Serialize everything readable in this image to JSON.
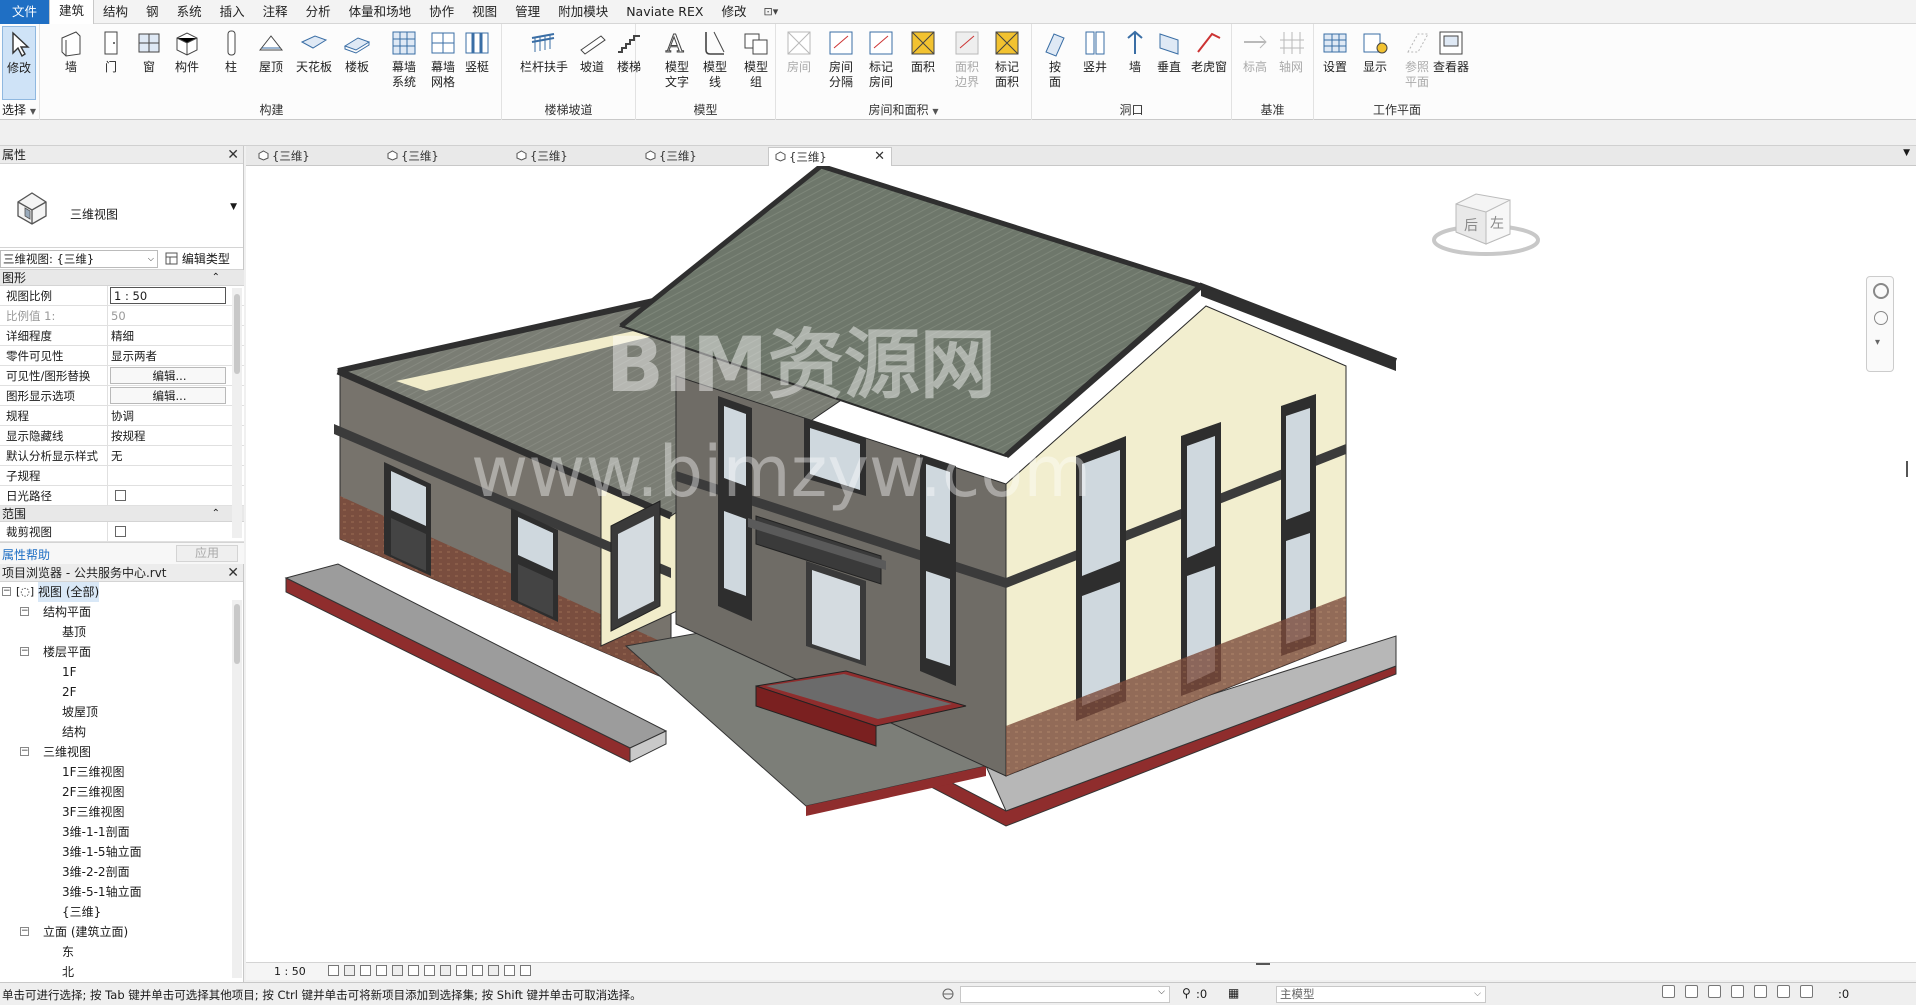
{
  "menu": {
    "items": [
      "文件",
      "建筑",
      "结构",
      "钢",
      "系统",
      "插入",
      "注释",
      "分析",
      "体量和场地",
      "协作",
      "视图",
      "管理",
      "附加模块",
      "Naviate REX",
      "修改"
    ],
    "active_index": 1
  },
  "ribbon": {
    "select": {
      "modify": "修改",
      "label": "选择"
    },
    "build": {
      "label": "构建",
      "buttons": [
        "墙",
        "门",
        "窗",
        "构件",
        "柱",
        "屋顶",
        "天花板",
        "楼板",
        "幕墙\n系统",
        "幕墙\n网格",
        "竖梃"
      ]
    },
    "circulation": {
      "label": "楼梯坡道",
      "buttons": [
        "栏杆扶手",
        "坡道",
        "楼梯"
      ]
    },
    "model": {
      "label": "模型",
      "buttons": [
        "模型\n文字",
        "模型\n线",
        "模型\n组"
      ]
    },
    "room_area": {
      "label": "房间和面积",
      "buttons": [
        "房间",
        "房间\n分隔",
        "标记\n房间",
        "面积",
        "面积\n边界",
        "标记\n面积"
      ]
    },
    "opening": {
      "label": "洞口",
      "buttons": [
        "按\n面",
        "竖井",
        "墙",
        "垂直",
        "老虎窗"
      ]
    },
    "datum": {
      "label": "基准",
      "buttons": [
        "标高",
        "轴网"
      ]
    },
    "workplane": {
      "label": "工作平面",
      "buttons": [
        "设置",
        "显示",
        "参照\n平面",
        "查看器"
      ]
    }
  },
  "properties": {
    "title": "属性",
    "type_name": "三维视图",
    "instance": "三维视图: {三维}",
    "edit_type": "编辑类型",
    "sections": [
      {
        "name": "图形",
        "rows": [
          {
            "name": "视图比例",
            "value": "1 : 50",
            "style": "boxed"
          },
          {
            "name": "比例值 1:",
            "value": "50",
            "style": "dim"
          },
          {
            "name": "详细程度",
            "value": "精细"
          },
          {
            "name": "零件可见性",
            "value": "显示两者"
          },
          {
            "name": "可见性/图形替换",
            "value": "编辑...",
            "style": "btn"
          },
          {
            "name": "图形显示选项",
            "value": "编辑...",
            "style": "btn"
          },
          {
            "name": "规程",
            "value": "协调"
          },
          {
            "name": "显示隐藏线",
            "value": "按规程"
          },
          {
            "name": "默认分析显示样式",
            "value": "无"
          },
          {
            "name": "子规程",
            "value": ""
          },
          {
            "name": "日光路径",
            "value": "",
            "style": "checkbox"
          }
        ]
      },
      {
        "name": "范围",
        "rows": [
          {
            "name": "裁剪视图",
            "value": "",
            "style": "checkbox"
          }
        ]
      }
    ],
    "help": "属性帮助",
    "apply": "应用"
  },
  "browser": {
    "title": "项目浏览器 - 公共服务中心.rvt",
    "tree": [
      {
        "label": "视图 (全部)",
        "level": 0,
        "toggle": "−",
        "selected": true
      },
      {
        "label": "结构平面",
        "level": 1,
        "toggle": "−"
      },
      {
        "label": "基顶",
        "level": 2
      },
      {
        "label": "楼层平面",
        "level": 1,
        "toggle": "−"
      },
      {
        "label": "1F",
        "level": 2
      },
      {
        "label": "2F",
        "level": 2
      },
      {
        "label": "坡屋顶",
        "level": 2
      },
      {
        "label": "结构",
        "level": 2
      },
      {
        "label": "三维视图",
        "level": 1,
        "toggle": "−"
      },
      {
        "label": "1F三维视图",
        "level": 2
      },
      {
        "label": "2F三维视图",
        "level": 2
      },
      {
        "label": "3F三维视图",
        "level": 2
      },
      {
        "label": "3维-1-1剖面",
        "level": 2
      },
      {
        "label": "3维-1-5轴立面",
        "level": 2
      },
      {
        "label": "3维-2-2剖面",
        "level": 2
      },
      {
        "label": "3维-5-1轴立面",
        "level": 2
      },
      {
        "label": "{三维}",
        "level": 2
      },
      {
        "label": "立面 (建筑立面)",
        "level": 1,
        "toggle": "−"
      },
      {
        "label": "东",
        "level": 2
      },
      {
        "label": "北",
        "level": 2
      }
    ]
  },
  "view_tabs": [
    {
      "label": "{三维}",
      "active": false
    },
    {
      "label": "{三维}",
      "active": false
    },
    {
      "label": "{三维}",
      "active": false
    },
    {
      "label": "{三维}",
      "active": false
    },
    {
      "label": "{三维}",
      "active": true
    }
  ],
  "viewcube": {
    "face_front": "后",
    "face_side": "左"
  },
  "watermark": {
    "line1": "BIM资源网",
    "line2": "www.bimzyw.com"
  },
  "view_control": {
    "scale": "1 : 50"
  },
  "status": {
    "text": "单击可进行选择; 按 Tab 键并单击可选择其他项目; 按 Ctrl 键并单击可将新项目添加到选择集; 按 Shift 键并单击可取消选择。",
    "workset_count": ":0",
    "model": "主模型",
    "filter_count": ":0"
  },
  "colors": {
    "accent": "#1f6fc4",
    "roof": "#6f786c",
    "wall_cream": "#f3efcf",
    "wall_grey": "#77736c",
    "base_red": "#8f2d2d"
  }
}
